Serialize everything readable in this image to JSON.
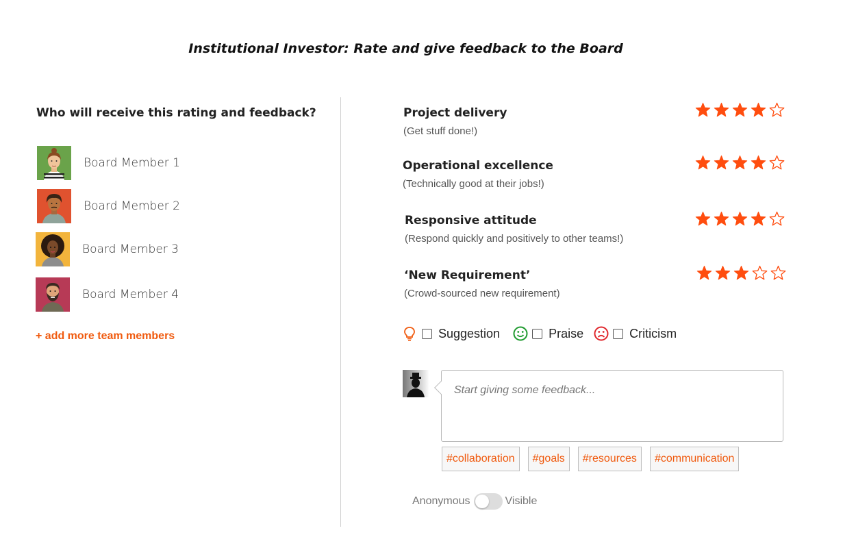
{
  "header": {
    "title": "Institutional Investor: Rate and give feedback to the Board"
  },
  "recipients": {
    "heading": "Who will receive this rating and feedback?",
    "members": [
      {
        "name": "Board Member 1",
        "avatar_bg": "#6aa34a"
      },
      {
        "name": "Board Member 2",
        "avatar_bg": "#e0522f"
      },
      {
        "name": "Board Member 3",
        "avatar_bg": "#f2b43c"
      },
      {
        "name": "Board Member 4",
        "avatar_bg": "#b73a56"
      }
    ],
    "add_more_label": "+ add more team members"
  },
  "criteria": [
    {
      "title": "Project delivery",
      "subtitle": "(Get stuff done!)",
      "rating": 4,
      "max": 5
    },
    {
      "title": "Operational excellence",
      "subtitle": "(Technically good at their jobs!)",
      "rating": 4,
      "max": 5
    },
    {
      "title": "Responsive attitude",
      "subtitle": "(Respond quickly and positively to other teams!)",
      "rating": 4,
      "max": 5
    },
    {
      "title": "‘New Requirement’",
      "subtitle": "(Crowd-sourced new requirement)",
      "rating": 3,
      "max": 5
    }
  ],
  "feedback_types": [
    {
      "label": "Suggestion",
      "icon": "lightbulb-icon",
      "checked": false
    },
    {
      "label": "Praise",
      "icon": "smiley-icon",
      "checked": false
    },
    {
      "label": "Criticism",
      "icon": "sad-face-icon",
      "checked": false
    }
  ],
  "comment": {
    "placeholder": "Start giving some feedback..."
  },
  "tags": [
    "#collaboration",
    "#goals",
    "#resources",
    "#communication"
  ],
  "visibility": {
    "left_label": "Anonymous",
    "right_label": "Visible"
  },
  "colors": {
    "accent": "#f05a0e",
    "star": "#ff4d0f",
    "praise": "#1e9a2e",
    "criticism": "#e0262b"
  }
}
